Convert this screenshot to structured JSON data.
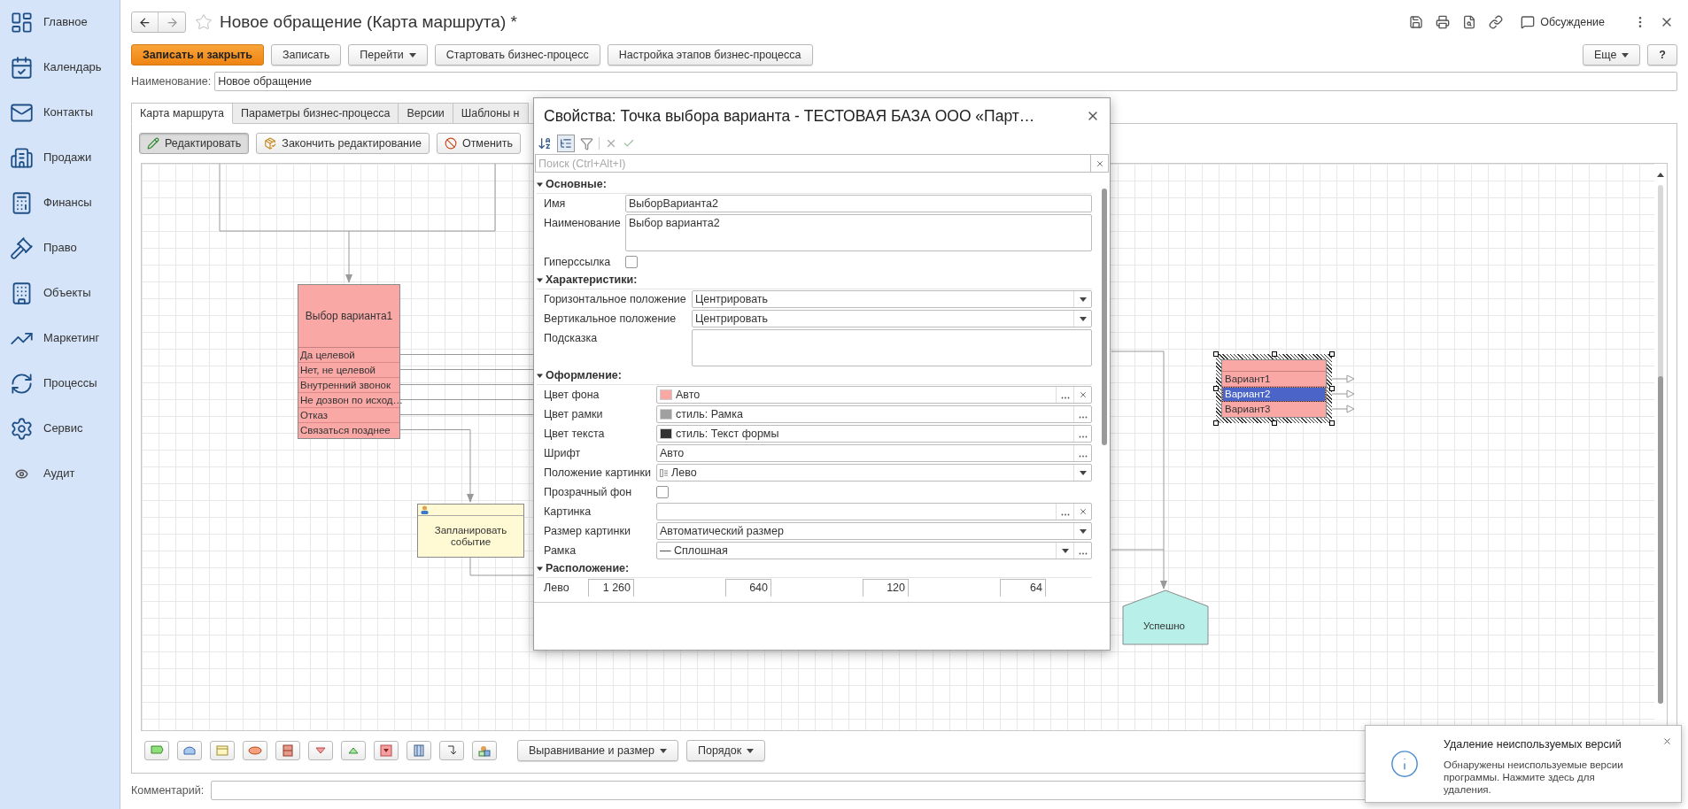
{
  "sidebar": {
    "items": [
      {
        "label": "Главное"
      },
      {
        "label": "Календарь"
      },
      {
        "label": "Контакты"
      },
      {
        "label": "Продажи"
      },
      {
        "label": "Финансы"
      },
      {
        "label": "Право"
      },
      {
        "label": "Объекты"
      },
      {
        "label": "Маркетинг"
      },
      {
        "label": "Процессы"
      },
      {
        "label": "Сервис"
      },
      {
        "label": "Аудит"
      }
    ]
  },
  "header": {
    "title": "Новое обращение (Карта маршрута) *",
    "favorite": false,
    "discussion": "Обсуждение"
  },
  "actions": {
    "buttons": [
      {
        "label": "Записать и закрыть",
        "kind": "primary"
      },
      {
        "label": "Записать",
        "kind": "plain"
      },
      {
        "label": "Перейти",
        "kind": "menu"
      },
      {
        "label": "Стартовать бизнес-процесс",
        "kind": "plain"
      },
      {
        "label": "Настройка этапов бизнес-процесса",
        "kind": "plain"
      }
    ],
    "more": "Еще",
    "help": "?"
  },
  "name_field": {
    "label": "Наименование:",
    "value": "Новое обращение"
  },
  "tabs": [
    {
      "label": "Карта маршрута",
      "selected": true
    },
    {
      "label": "Параметры бизнес-процесса",
      "selected": false
    },
    {
      "label": "Версии",
      "selected": false
    },
    {
      "label": "Шаблоны н",
      "selected": false
    }
  ],
  "edit_toolbar": [
    {
      "label": "Редактировать",
      "selected": true
    },
    {
      "label": "Закончить редактирование",
      "selected": false
    },
    {
      "label": "Отменить",
      "selected": false
    }
  ],
  "diagram": {
    "choice_nodes": [
      {
        "title": "Выбор варианта1",
        "selected": false,
        "rows": [
          {
            "label": "Да целевой",
            "selected": false
          },
          {
            "label": "Нет, не целевой",
            "selected": false
          },
          {
            "label": "Внутренний звонок",
            "selected": false
          },
          {
            "label": "Не дозвон по исход…",
            "selected": false
          },
          {
            "label": "Отказ",
            "selected": false
          },
          {
            "label": "Связаться позднее",
            "selected": false
          }
        ]
      },
      {
        "selected": true,
        "rows": [
          {
            "label": "Вариант1",
            "selected": false
          },
          {
            "label": "Вариант2",
            "selected": true
          },
          {
            "label": "Вариант3",
            "selected": false
          }
        ]
      }
    ],
    "task_node": {
      "title": "Запланировать событие"
    },
    "end_node": {
      "title": "Успешно"
    }
  },
  "shape_toolbar": {
    "menus": [
      "Выравнивание и размер",
      "Порядок"
    ]
  },
  "comment": {
    "label": "Комментарий:"
  },
  "properties_dialog": {
    "title": "Свойства: Точка выбора варианта - ТЕСТОВАЯ БАЗА ООО «Парт…",
    "search_placeholder": "Поиск (Ctrl+Alt+I)",
    "sections": [
      {
        "title": "Основные:",
        "expanded": true,
        "rows": [
          {
            "label": "Имя",
            "kind": "text",
            "value": "ВыборВарианта2"
          },
          {
            "label": "Наименование",
            "kind": "textarea",
            "value": "Выбор варианта2"
          },
          {
            "label": "Гиперссылка",
            "kind": "checkbox",
            "checked": false
          }
        ]
      },
      {
        "title": "Характеристики:",
        "expanded": true,
        "rows": [
          {
            "label": "Горизонтальное положение",
            "kind": "field",
            "value": "Центрировать",
            "dropdown": true,
            "more": false,
            "clear": false,
            "value_icon": false
          },
          {
            "label": "Вертикальное положение",
            "kind": "field",
            "value": "Центрировать",
            "dropdown": true,
            "more": false,
            "clear": false,
            "value_icon": false
          },
          {
            "label": "Подсказка",
            "kind": "textarea"
          }
        ]
      },
      {
        "title": "Оформление:",
        "expanded": true,
        "rows": [
          {
            "label": "Цвет фона",
            "kind": "field",
            "value": "Авто",
            "color": "#f9a8a6",
            "dropdown": false,
            "more": true,
            "clear": true,
            "value_icon": false
          },
          {
            "label": "Цвет рамки",
            "kind": "field",
            "value": "стиль: Рамка",
            "color": "#a0a0a0",
            "dropdown": false,
            "more": true,
            "clear": false,
            "value_icon": false
          },
          {
            "label": "Цвет текста",
            "kind": "field",
            "value": "стиль: Текст формы",
            "color": "#333333",
            "dropdown": false,
            "more": true,
            "clear": false,
            "value_icon": false
          },
          {
            "label": "Шрифт",
            "kind": "field",
            "value": "Авто",
            "dropdown": false,
            "more": true,
            "clear": false,
            "value_icon": false
          },
          {
            "label": "Положение картинки",
            "kind": "field",
            "value": "Лево",
            "dropdown": true,
            "more": false,
            "clear": false,
            "value_icon": true
          },
          {
            "label": "Прозрачный фон",
            "kind": "checkbox",
            "checked": false
          },
          {
            "label": "Картинка",
            "kind": "field",
            "dropdown": false,
            "more": true,
            "clear": true,
            "value_icon": false
          },
          {
            "label": "Размер картинки",
            "kind": "field",
            "value": "Автоматический размер",
            "dropdown": true,
            "more": false,
            "clear": false,
            "value_icon": false
          },
          {
            "label": "Рамка",
            "kind": "field",
            "value": "— Сплошная",
            "dropdown": true,
            "more": true,
            "clear": false,
            "value_icon": false
          }
        ]
      },
      {
        "title": "Расположение:",
        "expanded": true,
        "rows": [
          {
            "label": "Лево",
            "kind": "numbers",
            "values": [
              "1 260",
              "640",
              "120",
              "64"
            ]
          }
        ]
      }
    ]
  },
  "notification": {
    "title": "Удаление неиспользуемых версий",
    "text": "Обнаружены неиспользуемые версии программы. Нажмите здесь для удаления."
  }
}
